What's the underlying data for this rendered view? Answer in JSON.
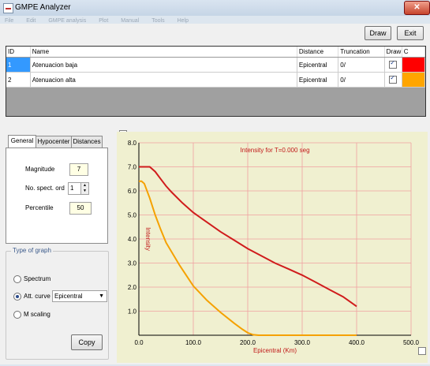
{
  "window": {
    "title": "GMPE Analyzer",
    "close_symbol": "✕"
  },
  "menubar": [
    "File",
    "Edit",
    "GMPE analysis",
    "Plot",
    "Manual",
    "Tools",
    "Help"
  ],
  "toolbar": {
    "draw_label": "Draw",
    "exit_label": "Exit"
  },
  "grid": {
    "columns": [
      "ID",
      "Name",
      "Distance",
      "Truncation",
      "Draw",
      "C"
    ],
    "rows": [
      {
        "id": "1",
        "name": "Atenuacion baja",
        "distance": "Epicentral",
        "truncation": "0/",
        "draw": true,
        "color": "#ff0000"
      },
      {
        "id": "2",
        "name": "Atenuacion alta",
        "distance": "Epicentral",
        "truncation": "0/",
        "draw": true,
        "color": "#ffa500"
      }
    ]
  },
  "tabs": [
    "General",
    "Hypocenter",
    "Distances"
  ],
  "general": {
    "magnitude_label": "Magnitude",
    "magnitude_value": "7",
    "spect_label": "No. spect. ord",
    "spect_value": "1",
    "percentile_label": "Percentile",
    "percentile_value": "50"
  },
  "type_of_graph": {
    "title": "Type of graph",
    "spectrum_label": "Spectrum",
    "att_curve_label": "Att. curve",
    "att_curve_select": "Epicentral",
    "m_scaling_label": "M scaling",
    "copy_label": "Copy",
    "selected": "att_curve"
  },
  "chart_data": {
    "type": "line",
    "title": "Intensity for T=0.000 seg",
    "xlabel": "Epicentral (Km)",
    "ylabel": "Intensity",
    "xlim": [
      0,
      500
    ],
    "ylim": [
      0,
      8
    ],
    "xticks": [
      "0.0",
      "100.0",
      "200.0",
      "300.0",
      "400.0",
      "500.0"
    ],
    "yticks": [
      "1.0",
      "2.0",
      "3.0",
      "4.0",
      "5.0",
      "6.0",
      "7.0",
      "8.0"
    ],
    "grid": true,
    "series": [
      {
        "color": "#d01c1c",
        "x": [
          0,
          10,
          20,
          30,
          40,
          50,
          60,
          80,
          100,
          125,
          150,
          175,
          200,
          225,
          250,
          275,
          300,
          325,
          350,
          375,
          400
        ],
        "y": [
          7.0,
          7.0,
          7.0,
          6.8,
          6.5,
          6.2,
          5.95,
          5.5,
          5.1,
          4.7,
          4.3,
          3.95,
          3.6,
          3.3,
          3.0,
          2.75,
          2.5,
          2.2,
          1.9,
          1.6,
          1.2
        ]
      },
      {
        "color": "#f5a100",
        "x": [
          0,
          5,
          10,
          20,
          30,
          40,
          50,
          75,
          100,
          125,
          150,
          175,
          190,
          200,
          210,
          220,
          250,
          300,
          350,
          400
        ],
        "y": [
          6.4,
          6.4,
          6.3,
          5.7,
          5.0,
          4.4,
          3.85,
          2.9,
          2.05,
          1.45,
          0.95,
          0.5,
          0.25,
          0.1,
          0.02,
          0.0,
          0.0,
          0.0,
          0.0,
          0.0
        ]
      }
    ],
    "colors": {
      "background": "#f0f0d0",
      "grid": "#f0a0a0",
      "axis": "#000000",
      "text": "#c01818"
    }
  }
}
